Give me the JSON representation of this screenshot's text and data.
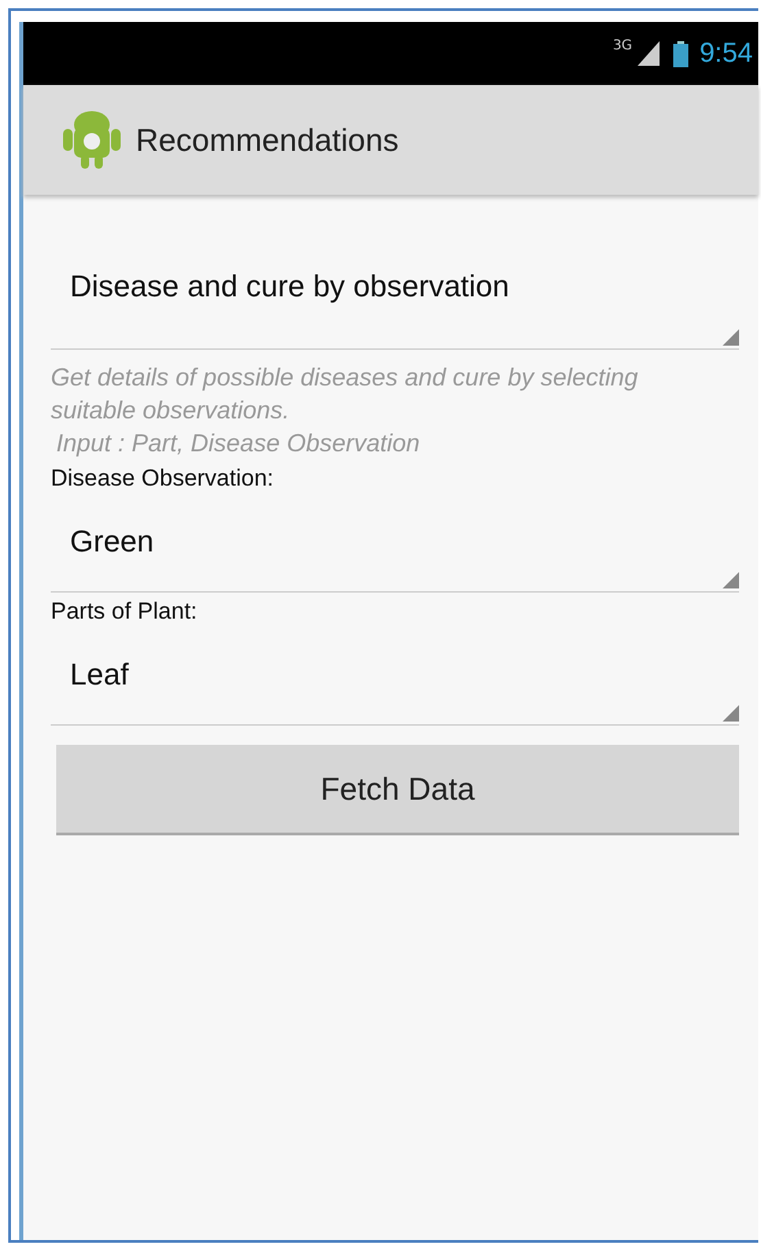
{
  "status_bar": {
    "time": "9:54",
    "network": "3G"
  },
  "action_bar": {
    "title": "Recommendations"
  },
  "mode_spinner": {
    "value": "Disease and cure by observation"
  },
  "description": "Get details of possible diseases and cure by selecting suitable observations.",
  "input_hint": "Input : Part, Disease Observation",
  "fields": [
    {
      "label": "Disease Observation:",
      "value": "Green"
    },
    {
      "label": "Parts of Plant:",
      "value": "Leaf"
    }
  ],
  "button": "Fetch Data"
}
